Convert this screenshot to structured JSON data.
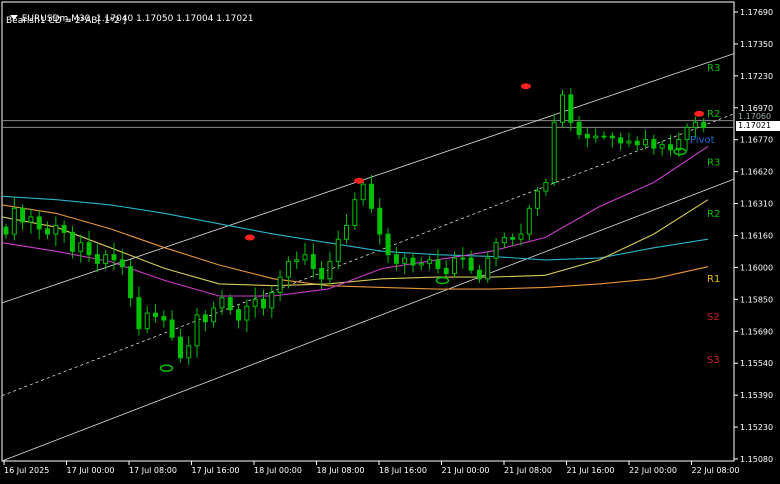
{
  "header": {
    "symbol_line": "EURUSDm,M30  1.17040 1.17050 1.17004 1.17021",
    "indicator_line": "Bearish1 CD = 2*AB[ 1*2 ]"
  },
  "price_tags": {
    "bid": "1.17021",
    "ask": "1.17060"
  },
  "chart_data": {
    "type": "candlestick",
    "title": "",
    "y_ticks": [
      "1.17690",
      "1.17350",
      "1.17230",
      "1.16970",
      "1.16770",
      "1.16620",
      "1.16310",
      "1.16160",
      "1.16000",
      "1.15850",
      "1.15690",
      "1.15540",
      "1.15390",
      "1.15230",
      "1.15080"
    ],
    "ylim": [
      1.1508,
      1.1775
    ],
    "x_ticks": [
      "16 Jul 2025",
      "17 Jul 00:00",
      "17 Jul 08:00",
      "17 Jul 16:00",
      "18 Jul 00:00",
      "18 Jul 08:00",
      "18 Jul 16:00",
      "21 Jul 00:00",
      "21 Jul 08:00",
      "21 Jul 16:00",
      "22 Jul 00:00",
      "22 Jul 08:00"
    ],
    "close_path": [
      1.164,
      1.1655,
      1.1647,
      1.165,
      1.1643,
      1.164,
      1.1645,
      1.1641,
      1.163,
      1.1635,
      1.1628,
      1.1623,
      1.1628,
      1.1625,
      1.1621,
      1.1603,
      1.1585,
      1.1594,
      1.1592,
      1.159,
      1.158,
      1.1568,
      1.1575,
      1.1593,
      1.1589,
      1.1597,
      1.1603,
      1.1596,
      1.159,
      1.1598,
      1.1602,
      1.1597,
      1.1606,
      1.1615,
      1.1624,
      1.1625,
      1.1628,
      1.162,
      1.1614,
      1.1624,
      1.1637,
      1.1645,
      1.166,
      1.1669,
      1.1655,
      1.164,
      1.1628,
      1.1623,
      1.1626,
      1.1622,
      1.1623,
      1.1625,
      1.162,
      1.1617,
      1.1626,
      1.1626,
      1.1619,
      1.1614,
      1.1626,
      1.1635,
      1.1638,
      1.1637,
      1.164,
      1.1655,
      1.1665,
      1.167,
      1.1705,
      1.1721,
      1.1705,
      1.1698,
      1.1696,
      1.1697,
      1.1697,
      1.1696,
      1.1693,
      1.1694,
      1.1692,
      1.1695,
      1.169,
      1.1692,
      1.1689,
      1.1695,
      1.1702,
      1.1705,
      1.1702
    ],
    "moving_averages": [
      {
        "color": "#2bb3c8",
        "values": [
          1.1662,
          1.166,
          1.1657,
          1.1652,
          1.1646,
          1.164,
          1.1635,
          1.163,
          1.1628,
          1.1627,
          1.1625,
          1.1626,
          1.1632,
          1.1637
        ]
      },
      {
        "color": "#e8963a",
        "values": [
          1.1657,
          1.1652,
          1.1643,
          1.1632,
          1.1622,
          1.1614,
          1.161,
          1.1609,
          1.1608,
          1.1608,
          1.1609,
          1.1611,
          1.1614,
          1.1621
        ]
      },
      {
        "color": "#d6c95a",
        "values": [
          1.165,
          1.1644,
          1.1632,
          1.162,
          1.1611,
          1.161,
          1.1611,
          1.1614,
          1.1615,
          1.1615,
          1.1616,
          1.1625,
          1.164,
          1.166
        ]
      },
      {
        "color": "#cc3ccc",
        "values": [
          1.1635,
          1.163,
          1.1624,
          1.1613,
          1.1604,
          1.1604,
          1.1608,
          1.162,
          1.1625,
          1.163,
          1.1638,
          1.1656,
          1.167,
          1.1691
        ]
      }
    ],
    "pivot_labels": [
      {
        "text": "R3",
        "color": "#00c000",
        "value": 1.1735
      },
      {
        "text": "R2",
        "color": "#00c000",
        "value": 1.1708
      },
      {
        "text": "Pivot",
        "color": "#1e6cd8",
        "value": 1.1693
      },
      {
        "text": "R3",
        "color": "#00c000",
        "value": 1.168
      },
      {
        "text": "R2",
        "color": "#00c000",
        "value": 1.165
      },
      {
        "text": "R1",
        "color": "#00c000",
        "value": 1.1612
      },
      {
        "text": "R1",
        "color": "#e0a000",
        "value": 1.1612
      },
      {
        "text": "S2",
        "color": "#d02020",
        "value": 1.159
      },
      {
        "text": "S3",
        "color": "#d02020",
        "value": 1.1565
      }
    ],
    "swing_marks": [
      {
        "kind": "high",
        "color": "#ff2020",
        "idx": 38,
        "value": 1.1638
      },
      {
        "kind": "high",
        "color": "#ff2020",
        "idx": 55,
        "value": 1.1671
      },
      {
        "kind": "high",
        "color": "#ff2020",
        "idx": 81,
        "value": 1.1726
      },
      {
        "kind": "low",
        "color": "#00c000",
        "idx": 25,
        "value": 1.1562
      },
      {
        "kind": "low",
        "color": "#00c000",
        "idx": 68,
        "value": 1.1613
      },
      {
        "kind": "low",
        "color": "#00c000",
        "idx": 105,
        "value": 1.1688
      },
      {
        "kind": "high",
        "color": "#ff2020",
        "idx": 108,
        "value": 1.171
      }
    ],
    "horizontal_lines": [
      1.1706,
      1.17021
    ],
    "colors": {
      "candle": "#00c000",
      "background": "#000000",
      "axis": "#ffffff"
    }
  }
}
